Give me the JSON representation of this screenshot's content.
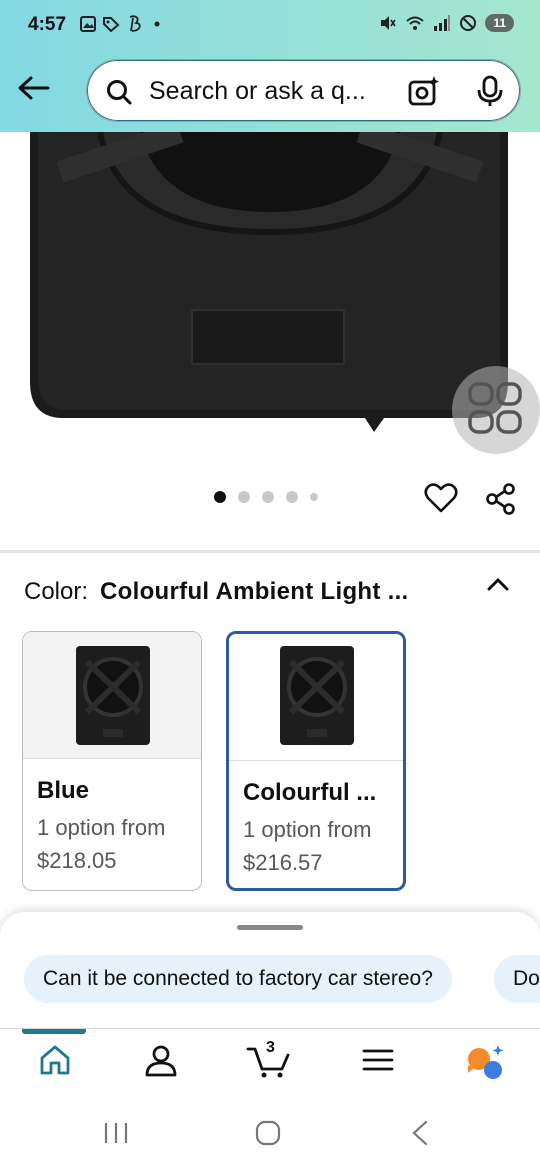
{
  "status_bar": {
    "time": "4:57",
    "battery": "11"
  },
  "search": {
    "placeholder": "Search or ask a q..."
  },
  "gallery": {
    "dots": 5,
    "active_index": 0
  },
  "color_selector": {
    "label": "Color:",
    "selected_value": "Colourful Ambient Light ..."
  },
  "variants": [
    {
      "name": "Blue",
      "options": "1 option from",
      "price": "$218.05",
      "selected": false
    },
    {
      "name": "Colourful ...",
      "options": "1 option from",
      "price": "$216.57",
      "selected": true
    }
  ],
  "suggestions": [
    "Can it be connected to factory car stereo?",
    "Do"
  ],
  "tabbar": {
    "cart_count": "3"
  },
  "colors": {
    "accent": "#1f7a8c",
    "selected_border": "#2f5aa0",
    "chip_bg": "#e5f2fb"
  }
}
